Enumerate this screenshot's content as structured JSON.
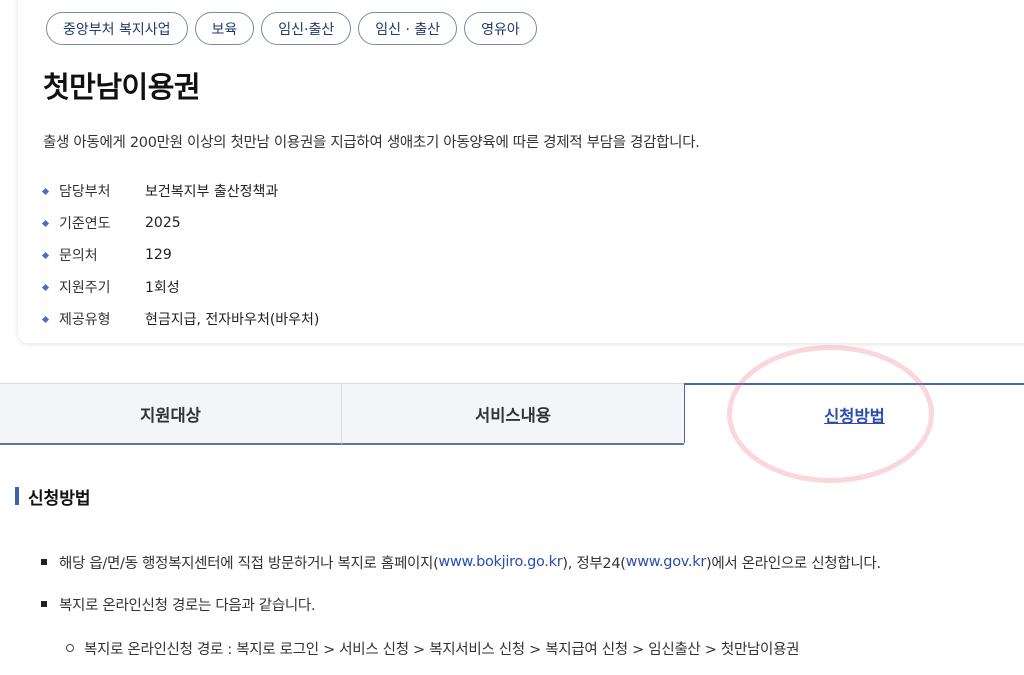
{
  "tags": [
    "중앙부처 복지사업",
    "보육",
    "임신·출산",
    "임신 · 출산",
    "영유아"
  ],
  "title": "첫만남이용권",
  "description": "출생 아동에게 200만원 이상의 첫만남 이용권을 지급하여 생애초기 아동양육에 따른 경제적 부담을 경감합니다.",
  "info": [
    {
      "label": "담당부처",
      "value": "보건복지부 출산정책과"
    },
    {
      "label": "기준연도",
      "value": "2025"
    },
    {
      "label": "문의처",
      "value": "129"
    },
    {
      "label": "지원주기",
      "value": "1회성"
    },
    {
      "label": "제공유형",
      "value": "현금지급, 전자바우처(바우처)"
    }
  ],
  "tabs": [
    "지원대상",
    "서비스내용",
    "신청방법"
  ],
  "active_tab": "신청방법",
  "section_title": "신청방법",
  "method": {
    "line1_a": "해당 읍/면/동 행정복지센터에 직접 방문하거나 복지로 홈페이지(",
    "line1_link1": "www.bokjiro.go.kr",
    "line1_b": "), 정부24(",
    "line1_link2": "www.gov.kr",
    "line1_c": ")에서 온라인으로 신청합니다.",
    "line2": "복지로 온라인신청 경로는 다음과 같습니다.",
    "line3": "복지로 온라인신청 경로 : 복지로 로그인 > 서비스 신청 > 복지서비스 신청 > 복지급여 신청 > 임신출산 > 첫만남이용권"
  },
  "colors": {
    "accent": "#3f5fb0",
    "link": "#2a4db0",
    "tag_text": "#1f3a6b"
  }
}
